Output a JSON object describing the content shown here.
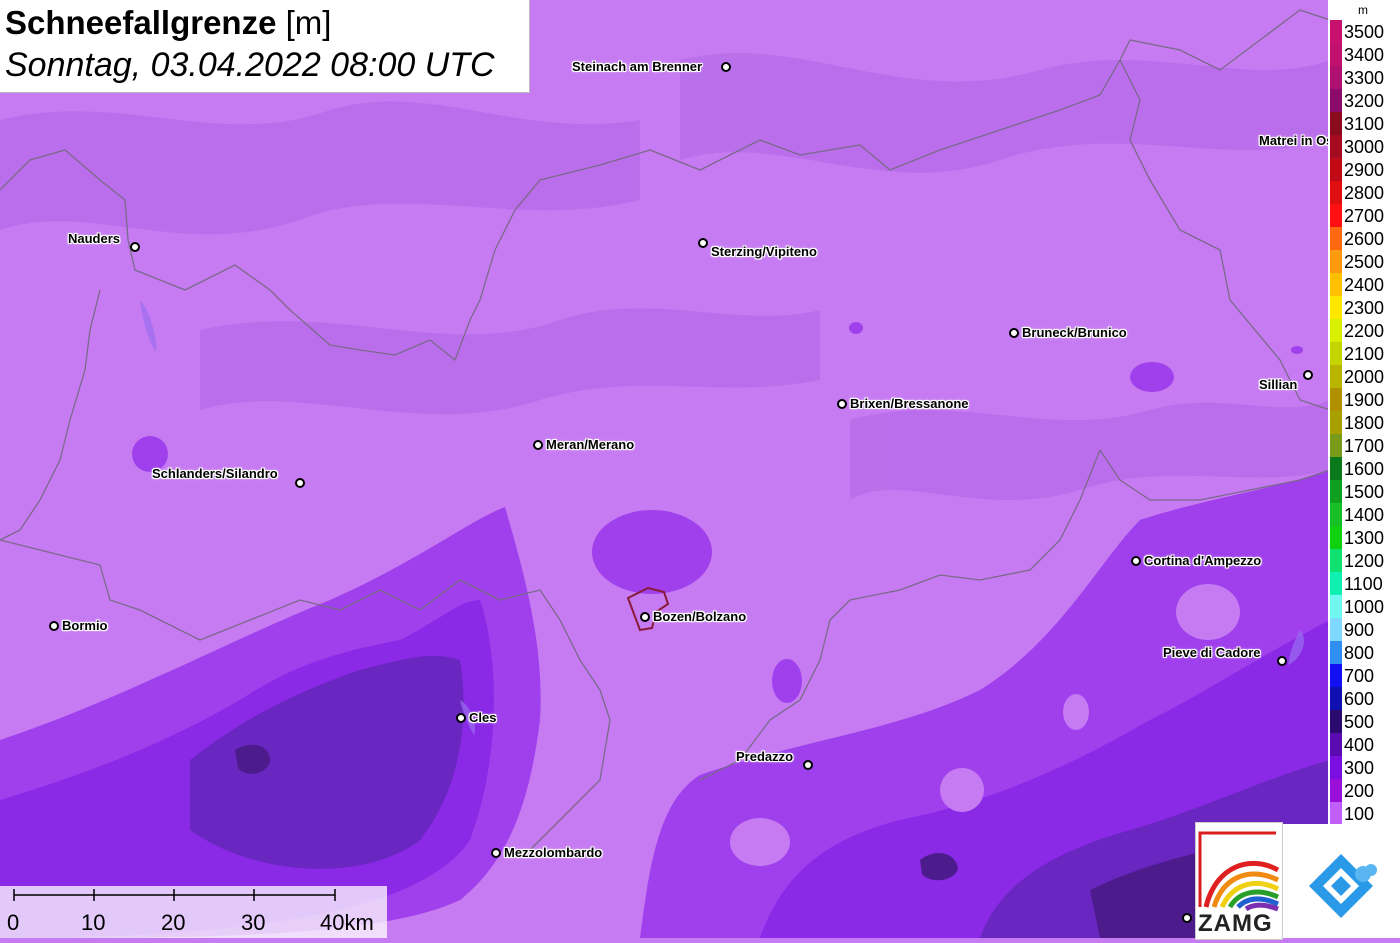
{
  "title": {
    "variable": "Schneefallgrenze",
    "unit": "[m]",
    "datetime": "Sonntag, 03.04.2022 08:00 UTC"
  },
  "cities": [
    {
      "name": "Steinach am Brenner"
    },
    {
      "name": "Nauders"
    },
    {
      "name": "Sterzing/Vipiteno"
    },
    {
      "name": "Matrei in Osttirol"
    },
    {
      "name": "Bruneck/Brunico"
    },
    {
      "name": "Sillian"
    },
    {
      "name": "Brixen/Bressanone"
    },
    {
      "name": "Meran/Merano"
    },
    {
      "name": "Schlanders/Silandro"
    },
    {
      "name": "Cortina d'Ampezzo"
    },
    {
      "name": "Bormio"
    },
    {
      "name": "Bozen/Bolzano"
    },
    {
      "name": "Pieve di Cadore"
    },
    {
      "name": "Cles"
    },
    {
      "name": "Predazzo"
    },
    {
      "name": "Mezzolombardo"
    }
  ],
  "legend": {
    "unit": "m",
    "levels": [
      {
        "label": "3500",
        "color": "#c8106e"
      },
      {
        "label": "3400",
        "color": "#c0116f"
      },
      {
        "label": "3300",
        "color": "#b01070"
      },
      {
        "label": "3200",
        "color": "#8c0a6a"
      },
      {
        "label": "3100",
        "color": "#8a0b1c"
      },
      {
        "label": "3000",
        "color": "#a50b1e"
      },
      {
        "label": "2900",
        "color": "#c00a16"
      },
      {
        "label": "2800",
        "color": "#e01010"
      },
      {
        "label": "2700",
        "color": "#ff1010"
      },
      {
        "label": "2600",
        "color": "#ff6a10"
      },
      {
        "label": "2500",
        "color": "#ff9a10"
      },
      {
        "label": "2400",
        "color": "#ffc000"
      },
      {
        "label": "2300",
        "color": "#ffe800"
      },
      {
        "label": "2200",
        "color": "#d8f000"
      },
      {
        "label": "2100",
        "color": "#c4d400"
      },
      {
        "label": "2000",
        "color": "#b8b400"
      },
      {
        "label": "1900",
        "color": "#b09000"
      },
      {
        "label": "1800",
        "color": "#a8a000"
      },
      {
        "label": "1700",
        "color": "#7a9a1a"
      },
      {
        "label": "1600",
        "color": "#0a7a1a"
      },
      {
        "label": "1500",
        "color": "#10a020"
      },
      {
        "label": "1400",
        "color": "#18c028"
      },
      {
        "label": "1300",
        "color": "#10d010"
      },
      {
        "label": "1200",
        "color": "#10e070"
      },
      {
        "label": "1100",
        "color": "#10f0b0"
      },
      {
        "label": "1000",
        "color": "#70f8f0"
      },
      {
        "label": "900",
        "color": "#80d8ff"
      },
      {
        "label": "800",
        "color": "#3090f0"
      },
      {
        "label": "700",
        "color": "#1010f0"
      },
      {
        "label": "600",
        "color": "#1010b0"
      },
      {
        "label": "500",
        "color": "#2a0a70"
      },
      {
        "label": "400",
        "color": "#5a0ab0"
      },
      {
        "label": "300",
        "color": "#7a10e0"
      },
      {
        "label": "200",
        "color": "#9a10d8"
      },
      {
        "label": "100",
        "color": "#c060f8"
      }
    ]
  },
  "scalebar": {
    "ticks": [
      "0",
      "10",
      "20",
      "30",
      "40km"
    ]
  },
  "logos": {
    "zamg": "ZAMG",
    "partner": "cloud-drop-logo"
  },
  "colors": {
    "base": "#c67bf2",
    "zone_light": "#b468f0",
    "zone_200": "#9a32e6",
    "zone_300": "#7c22e2",
    "zone_400": "#6a24b4",
    "zone_500": "#4a1a8a",
    "border": "#7a6a8a"
  }
}
